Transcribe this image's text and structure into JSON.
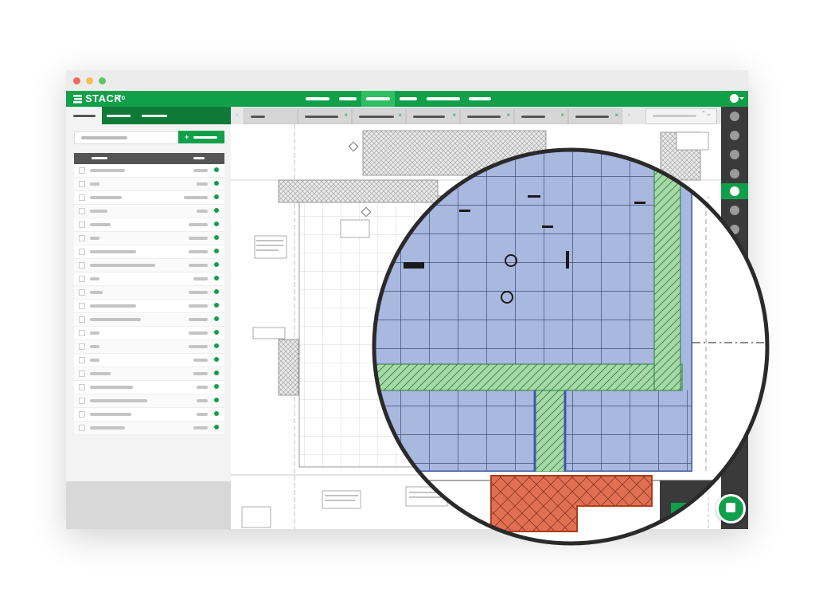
{
  "app": {
    "logo": "STACK",
    "edition": "Pro"
  },
  "colors": {
    "brand_green": "#11a04a",
    "dark_green": "#0f7a38",
    "area_blue": "#a9b8df",
    "area_blue_stroke": "#3b5aa6",
    "hatch_green": "#a6d8a8",
    "hatch_red": "#e07052",
    "rail_dark": "#3a3a3a"
  },
  "icons": {
    "logo": "stack-logo-icon",
    "user": "user-avatar-icon",
    "new_item": "plus-icon",
    "tab_close": "close-icon",
    "tab_prev": "chevron-left-icon",
    "tab_next": "chevron-right-icon",
    "page_select": "up-down-caret-icon",
    "takeoff_fab": "document-icon"
  },
  "sidebar": {
    "new_button_symbol": "+",
    "status_color": "#11a04a"
  },
  "toolbar": {
    "tab_prev_symbol": "‹",
    "tab_next_symbol": "›",
    "tab_close_symbol": "×",
    "page_select_symbol": "⌃⌄"
  }
}
